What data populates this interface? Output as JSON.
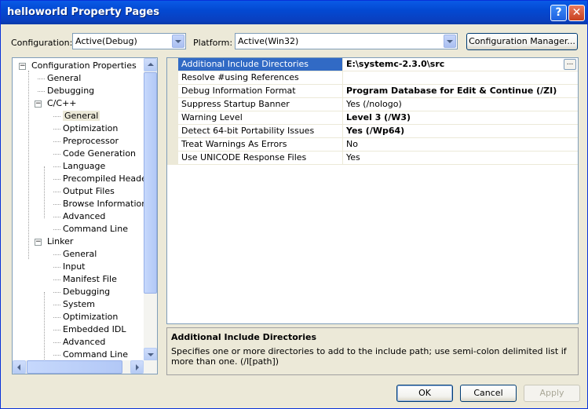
{
  "window": {
    "title": "helloworld Property Pages",
    "help_glyph": "?",
    "close_glyph": "✕"
  },
  "toolbar": {
    "configuration_label": "Configuration:",
    "configuration_value": "Active(Debug)",
    "platform_label": "Platform:",
    "platform_value": "Active(Win32)",
    "config_manager_label": "Configuration Manager..."
  },
  "tree": {
    "items": [
      {
        "label": "Configuration Properties",
        "level": 0,
        "expanded": true
      },
      {
        "label": "General",
        "level": 1
      },
      {
        "label": "Debugging",
        "level": 1
      },
      {
        "label": "C/C++",
        "level": 1,
        "expanded": true
      },
      {
        "label": "General",
        "level": 2,
        "selected": true
      },
      {
        "label": "Optimization",
        "level": 2
      },
      {
        "label": "Preprocessor",
        "level": 2
      },
      {
        "label": "Code Generation",
        "level": 2
      },
      {
        "label": "Language",
        "level": 2
      },
      {
        "label": "Precompiled Headers",
        "level": 2
      },
      {
        "label": "Output Files",
        "level": 2
      },
      {
        "label": "Browse Information",
        "level": 2
      },
      {
        "label": "Advanced",
        "level": 2
      },
      {
        "label": "Command Line",
        "level": 2
      },
      {
        "label": "Linker",
        "level": 1,
        "expanded": true
      },
      {
        "label": "General",
        "level": 2
      },
      {
        "label": "Input",
        "level": 2
      },
      {
        "label": "Manifest File",
        "level": 2
      },
      {
        "label": "Debugging",
        "level": 2
      },
      {
        "label": "System",
        "level": 2
      },
      {
        "label": "Optimization",
        "level": 2
      },
      {
        "label": "Embedded IDL",
        "level": 2
      },
      {
        "label": "Advanced",
        "level": 2
      },
      {
        "label": "Command Line",
        "level": 2
      }
    ]
  },
  "properties": [
    {
      "name": "Additional Include Directories",
      "value": "E:\\systemc-2.3.0\\src",
      "bold": true,
      "selected": true
    },
    {
      "name": "Resolve #using References",
      "value": ""
    },
    {
      "name": "Debug Information Format",
      "value": "Program Database for Edit & Continue (/ZI)",
      "bold": true
    },
    {
      "name": "Suppress Startup Banner",
      "value": "Yes (/nologo)"
    },
    {
      "name": "Warning Level",
      "value": "Level 3 (/W3)",
      "bold": true
    },
    {
      "name": "Detect 64-bit Portability Issues",
      "value": "Yes (/Wp64)",
      "bold": true
    },
    {
      "name": "Treat Warnings As Errors",
      "value": "No"
    },
    {
      "name": "Use UNICODE Response Files",
      "value": "Yes"
    }
  ],
  "ellipsis_label": "...",
  "description": {
    "title": "Additional Include Directories",
    "text": "Specifies one or more directories to add to the include path; use semi-colon delimited list if more than one.     (/I[path])"
  },
  "buttons": {
    "ok": "OK",
    "cancel": "Cancel",
    "apply": "Apply"
  }
}
